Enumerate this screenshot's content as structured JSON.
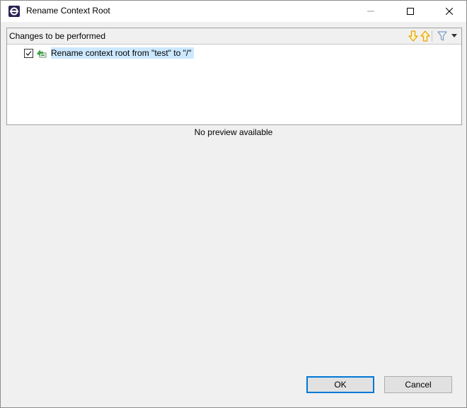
{
  "window": {
    "title": "Rename Context Root",
    "app_icon": "eclipse-icon",
    "controls": [
      "minimize-icon",
      "maximize-icon",
      "close-icon"
    ]
  },
  "changes_panel": {
    "title": "Changes to be performed",
    "toolbar": [
      "next-change-arrow-down-icon",
      "previous-change-arrow-up-icon",
      "filter-icon",
      "dropdown-chevron-icon"
    ],
    "items": [
      {
        "label": "Rename context root from \"test\" to \"/\"",
        "checked": true,
        "icon": "rename-change-icon"
      }
    ]
  },
  "preview": {
    "message": "No preview available"
  },
  "buttons": {
    "ok": "OK",
    "cancel": "Cancel"
  },
  "colors": {
    "selection": "#cce8ff",
    "default_button_border": "#0078d7",
    "arrow_orange": "#e8a400"
  }
}
